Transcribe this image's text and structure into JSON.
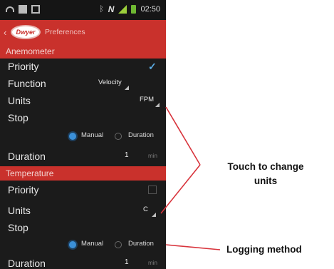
{
  "status_bar": {
    "time": "02:50",
    "icons": [
      "wifi-icon",
      "sd-card-icon",
      "gallery-icon",
      "bluetooth-icon",
      "nfc-icon",
      "signal-icon",
      "battery-icon"
    ]
  },
  "app_bar": {
    "logo_text": "Dwyer",
    "title": "Preferences"
  },
  "anemometer": {
    "section_title": "Anemometer",
    "priority_label": "Priority",
    "priority_checked": true,
    "function_label": "Function",
    "function_value": "Velocity",
    "units_label": "Units",
    "units_value": "FPM",
    "stop_label": "Stop",
    "stop_options": [
      "Manual",
      "Duration"
    ],
    "stop_selected": "Manual",
    "duration_label": "Duration",
    "duration_value": "1",
    "duration_unit": "min"
  },
  "temperature": {
    "section_title": "Temperature",
    "priority_label": "Priority",
    "priority_checked": false,
    "units_label": "Units",
    "units_value": "C",
    "stop_label": "Stop",
    "stop_options": [
      "Manual",
      "Duration"
    ],
    "stop_selected": "Manual",
    "duration_label": "Duration",
    "duration_value": "1",
    "duration_unit": "min"
  },
  "callouts": {
    "units_note": "Touch to change units",
    "units_note_line1": "Touch to change",
    "units_note_line2": "units",
    "logging_note": "Logging method"
  },
  "colors": {
    "accent_red": "#c9312c",
    "callout_line": "#d8343c",
    "radio_selected": "#3b90d8",
    "checkbox_checked": "#5aa9e0",
    "background": "#1b1b1b"
  }
}
